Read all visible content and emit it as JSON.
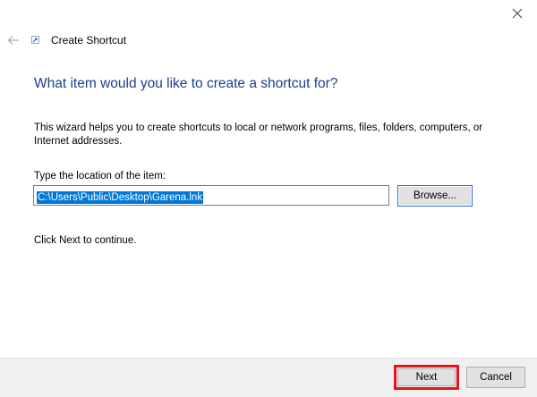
{
  "window": {
    "close_icon": "close-icon"
  },
  "header": {
    "back_icon": "back-arrow-icon",
    "app_icon": "shortcut-icon",
    "title": "Create Shortcut"
  },
  "main": {
    "heading": "What item would you like to create a shortcut for?",
    "description": "This wizard helps you to create shortcuts to local or network programs, files, folders, computers, or Internet addresses.",
    "location_label": "Type the location of the item:",
    "location_value": "C:\\Users\\Public\\Desktop\\Garena.lnk",
    "browse_label": "Browse...",
    "hint": "Click Next to continue."
  },
  "footer": {
    "next_label": "Next",
    "cancel_label": "Cancel",
    "highlight_color": "#e0151d"
  },
  "colors": {
    "heading": "#1a3e8c",
    "selection": "#0078d7"
  }
}
